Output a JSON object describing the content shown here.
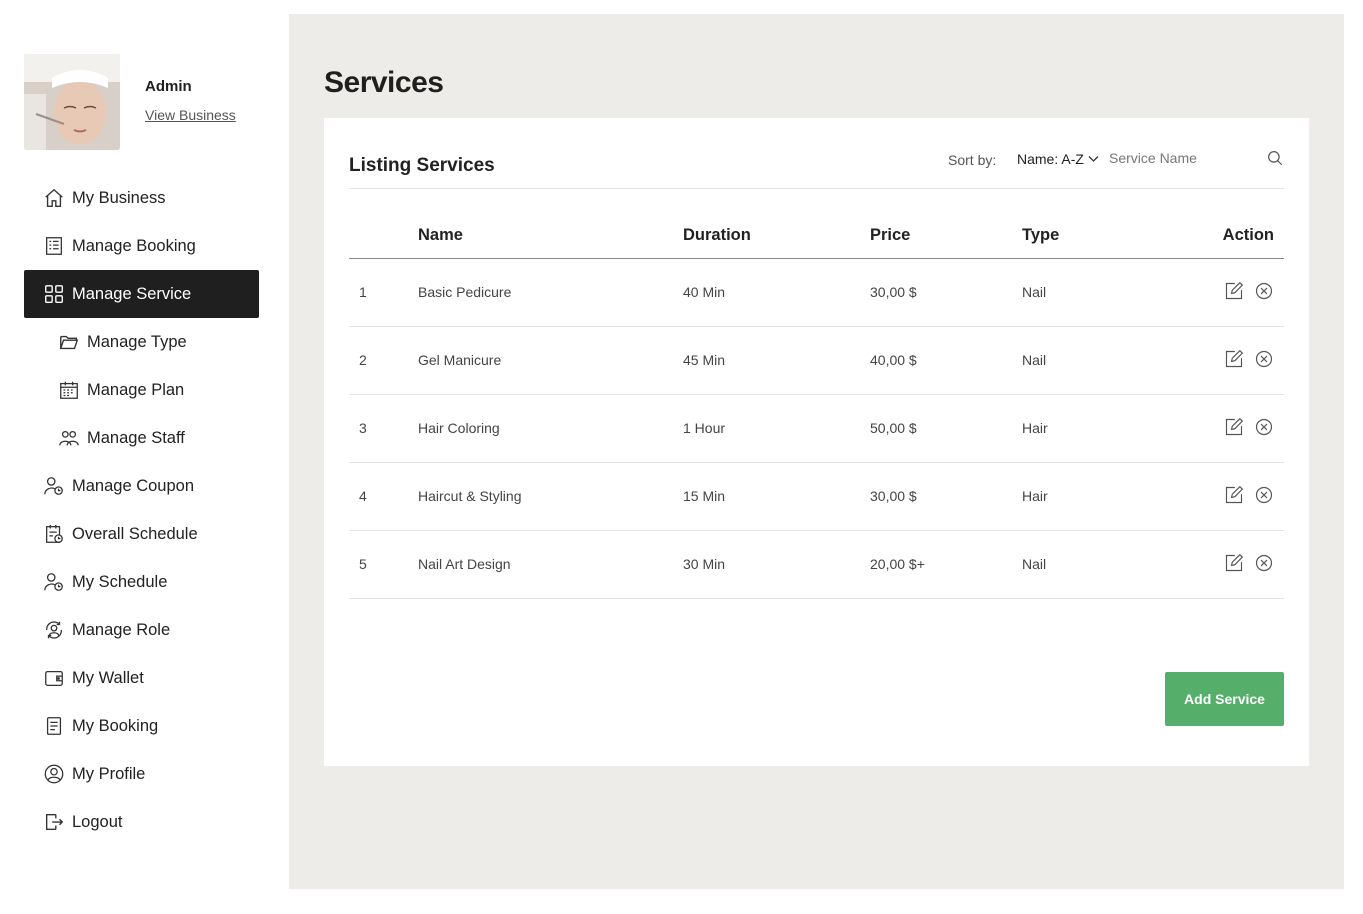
{
  "profile": {
    "name": "Admin",
    "link": "View Business"
  },
  "sidebar": {
    "items": [
      {
        "label": "My Business",
        "icon": "home-icon"
      },
      {
        "label": "Manage Booking",
        "icon": "booking-list-icon"
      },
      {
        "label": "Manage Service",
        "icon": "grid-icon",
        "active": true
      },
      {
        "label": "Manage Type",
        "icon": "folder-icon"
      },
      {
        "label": "Manage Plan",
        "icon": "calendar-icon"
      },
      {
        "label": "Manage Staff",
        "icon": "staff-icon"
      },
      {
        "label": "Manage Coupon",
        "icon": "user-clock-icon"
      },
      {
        "label": "Overall Schedule",
        "icon": "schedule-icon"
      },
      {
        "label": "My Schedule",
        "icon": "user-clock-icon"
      },
      {
        "label": "Manage Role",
        "icon": "role-icon"
      },
      {
        "label": "My Wallet",
        "icon": "wallet-icon"
      },
      {
        "label": "My Booking",
        "icon": "document-icon"
      },
      {
        "label": "My Profile",
        "icon": "user-circle-icon"
      },
      {
        "label": "Logout",
        "icon": "logout-icon"
      }
    ]
  },
  "main": {
    "title": "Services",
    "card_title": "Listing Services",
    "sort_label": "Sort by:",
    "sort_value": "Name: A-Z",
    "search_placeholder": "Service Name",
    "columns": [
      "",
      "Name",
      "Duration",
      "Price",
      "Type",
      "Action"
    ],
    "rows": [
      {
        "num": "1",
        "name": "Basic Pedicure",
        "duration": "40 Min",
        "price": "30,00 $",
        "type": "Nail"
      },
      {
        "num": "2",
        "name": "Gel Manicure",
        "duration": "45 Min",
        "price": "40,00 $",
        "type": "Nail"
      },
      {
        "num": "3",
        "name": "Hair Coloring",
        "duration": "1 Hour",
        "price": "50,00 $",
        "type": "Hair"
      },
      {
        "num": "4",
        "name": "Haircut & Styling",
        "duration": "15 Min",
        "price": "30,00 $",
        "type": "Hair"
      },
      {
        "num": "5",
        "name": "Nail Art Design",
        "duration": "30 Min",
        "price": "20,00 $+",
        "type": "Nail"
      }
    ],
    "add_button": "Add Service"
  },
  "colors": {
    "active_bg": "#1f1f1f",
    "main_bg": "#eeece8",
    "accent_green": "#55af6b"
  }
}
